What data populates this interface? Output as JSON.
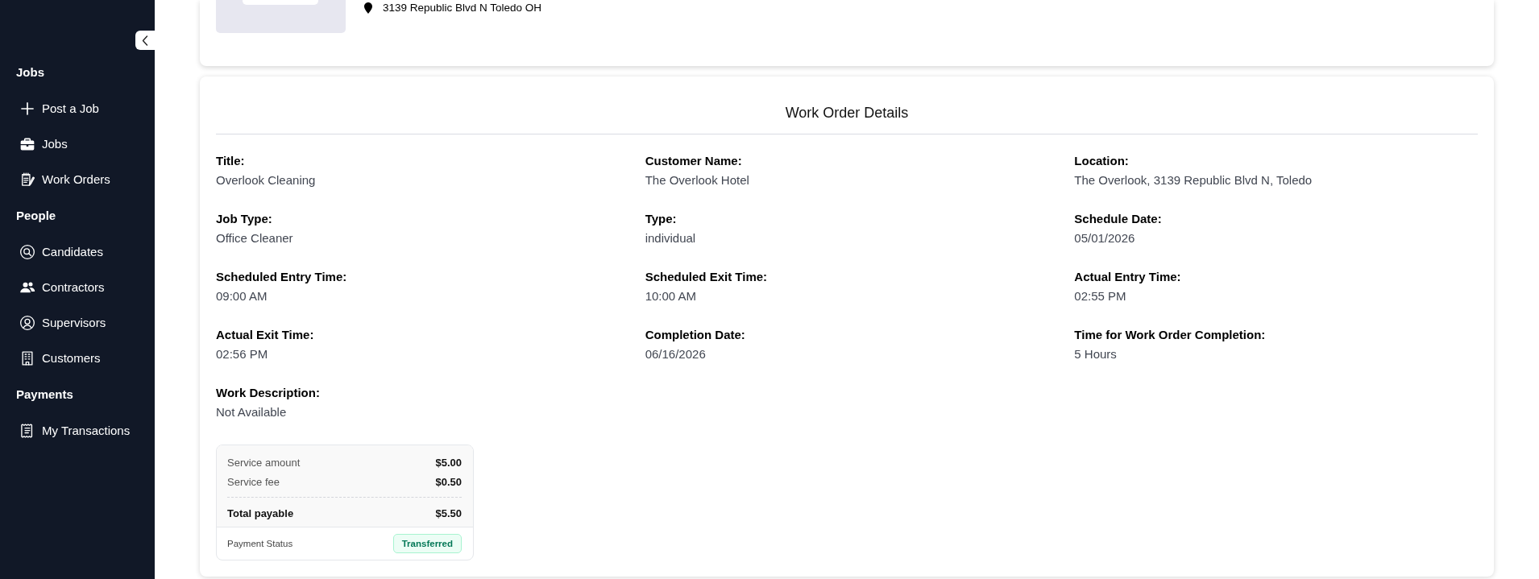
{
  "sidebar": {
    "sections": [
      {
        "heading": "Jobs",
        "items": [
          {
            "label": "Post a Job",
            "selected": false
          },
          {
            "label": "Jobs",
            "selected": false
          },
          {
            "label": "Work Orders",
            "selected": false
          }
        ]
      },
      {
        "heading": "People",
        "items": [
          {
            "label": "Candidates",
            "selected": false
          },
          {
            "label": "Contractors",
            "selected": false
          },
          {
            "label": "Supervisors",
            "selected": false
          },
          {
            "label": "Customers",
            "selected": false
          }
        ]
      },
      {
        "heading": "Payments",
        "items": [
          {
            "label": "My Transactions",
            "selected": false
          }
        ]
      }
    ]
  },
  "location_card": {
    "address": "3139 Republic Blvd N Toledo OH"
  },
  "work_order": {
    "title": "Work Order Details",
    "fields": [
      {
        "label": "Title:",
        "value": "Overlook Cleaning"
      },
      {
        "label": "Customer Name:",
        "value": "The Overlook Hotel"
      },
      {
        "label": "Location:",
        "value": "The Overlook, 3139 Republic Blvd N, Toledo"
      },
      {
        "label": "Job Type:",
        "value": "Office Cleaner"
      },
      {
        "label": "Type:",
        "value": "individual"
      },
      {
        "label": "Schedule Date:",
        "value": "05/01/2026"
      },
      {
        "label": "Scheduled Entry Time:",
        "value": "09:00 AM"
      },
      {
        "label": "Scheduled Exit Time:",
        "value": "10:00 AM"
      },
      {
        "label": "Actual Entry Time:",
        "value": "02:55 PM"
      },
      {
        "label": "Actual Exit Time:",
        "value": "02:56 PM"
      },
      {
        "label": "Completion Date:",
        "value": "06/16/2026"
      },
      {
        "label": "Time for Work Order Completion:",
        "value": "5 Hours"
      },
      {
        "label": "Work Description:",
        "value": "Not Available"
      }
    ],
    "payment": {
      "lines": [
        {
          "kind": "item",
          "label": "Service amount",
          "amount": "$5.00"
        },
        {
          "kind": "item",
          "label": "Service fee",
          "amount": "$0.50"
        },
        {
          "kind": "total",
          "label": "Total payable",
          "amount": "$5.50"
        }
      ],
      "status_label": "Payment Status",
      "status": "Transferred"
    }
  }
}
